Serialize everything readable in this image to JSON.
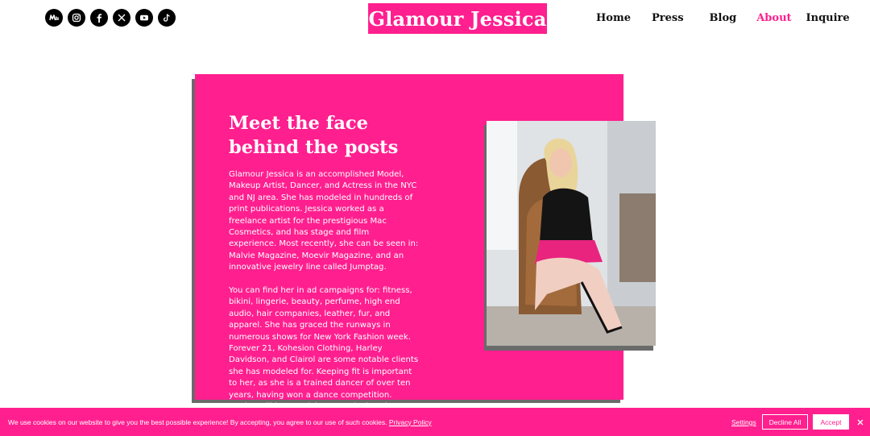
{
  "site": {
    "title": "Glamour Jessica",
    "brand_color": "#ff1f8f"
  },
  "social": [
    {
      "name": "medium-icon"
    },
    {
      "name": "instagram-icon"
    },
    {
      "name": "facebook-icon"
    },
    {
      "name": "x-icon"
    },
    {
      "name": "youtube-icon"
    },
    {
      "name": "tiktok-icon"
    }
  ],
  "nav": {
    "home": "Home",
    "press": "Press",
    "blog": "Blog",
    "about": "About",
    "inquire": "Inquire",
    "active": "About"
  },
  "about": {
    "heading_line1": "Meet the face",
    "heading_line2": "behind the posts",
    "paragraph1": "Glamour Jessica is an accomplished Model, Makeup Artist, Dancer, and Actress in the NYC and NJ area. She has modeled in hundreds of print publications. Jessica worked as a freelance artist for the prestigious Mac Cosmetics, and has stage and film experience. Most recently, she can be seen in: Malvie Magazine, Moevir Magazine, and an innovative jewelry line called Jumptag.",
    "paragraph2": "You can find her in ad campaigns for: fitness, bikini, lingerie, beauty, perfume, high end audio, hair companies, leather, fur, and apparel. She has graced the runways in numerous shows for New York Fashion week. Forever 21, Kohesion Clothing, Harley Davidson, and Clairol are some notable clients she has modeled for. Keeping fit is important to her, as she is a trained dancer of over ten years, having won a dance competition. Jessica will keep striving to make her dreams come true."
  },
  "cookie": {
    "message": "We use cookies on our website to give you the best possible experience! By accepting, you agree to our use of such cookies.",
    "policy_link": "Privacy Policy",
    "settings": "Settings",
    "decline": "Decline All",
    "accept": "Accept"
  }
}
